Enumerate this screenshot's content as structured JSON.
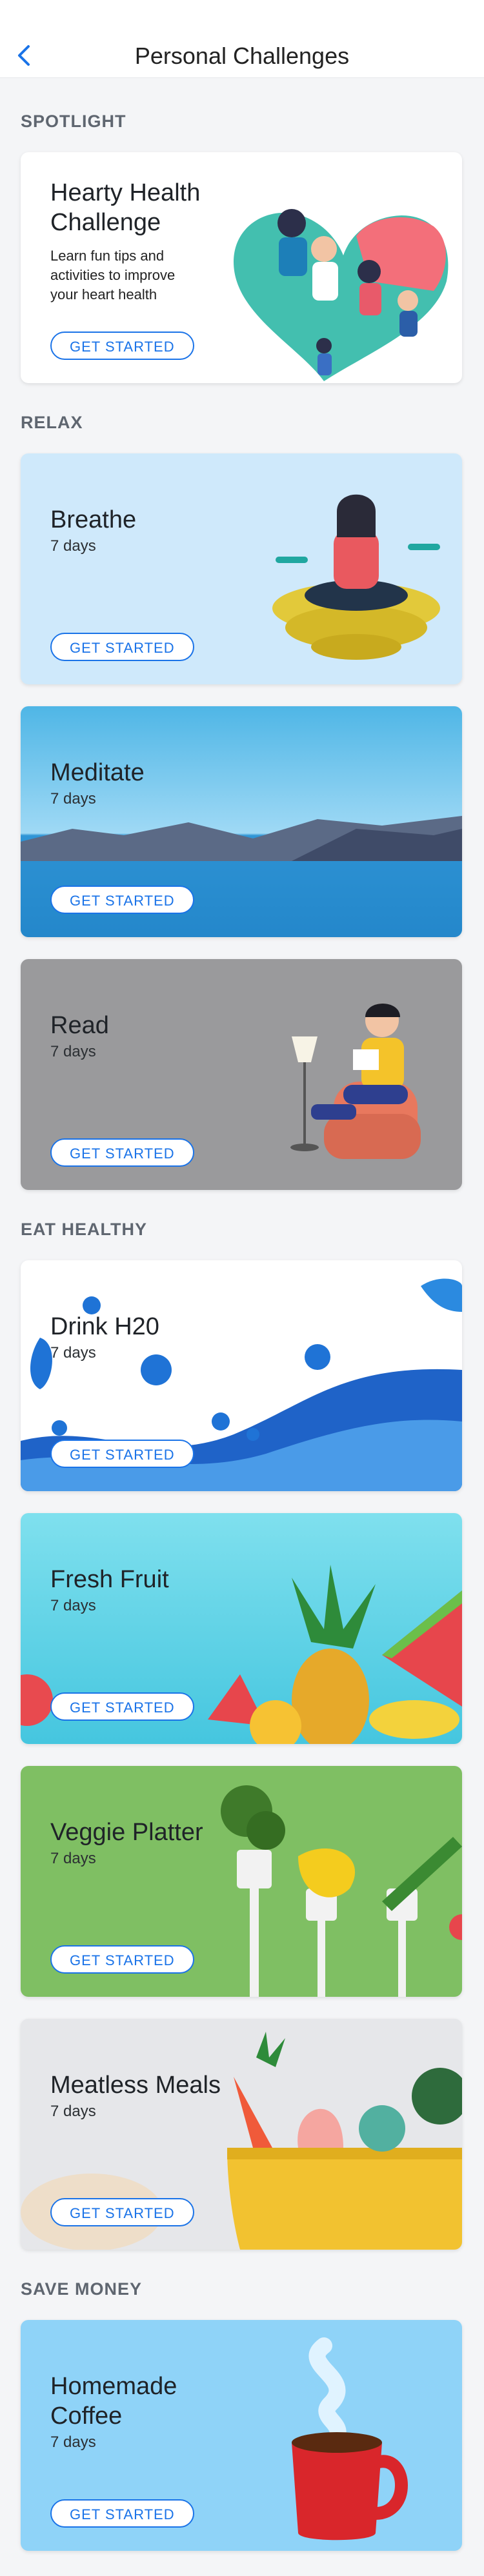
{
  "header": {
    "title": "Personal Challenges",
    "back_icon": "chevron-left-icon"
  },
  "sections": {
    "spotlight": {
      "title": "SPOTLIGHT"
    },
    "relax": {
      "title": "RELAX"
    },
    "eat": {
      "title": "EAT HEALTHY"
    },
    "money": {
      "title": "SAVE MONEY"
    }
  },
  "cards": {
    "hearty": {
      "name": "Hearty Health Challenge",
      "desc": "Learn fun tips and activities to improve your heart health",
      "button": "GET STARTED"
    },
    "breathe": {
      "name": "Breathe",
      "sub": "7 days",
      "button": "GET STARTED"
    },
    "meditate": {
      "name": "Meditate",
      "sub": "7 days",
      "button": "GET STARTED"
    },
    "read": {
      "name": "Read",
      "sub": "7 days",
      "button": "GET STARTED"
    },
    "drink": {
      "name": "Drink H20",
      "sub": "7 days",
      "button": "GET STARTED"
    },
    "fruit": {
      "name": "Fresh Fruit",
      "sub": "7 days",
      "button": "GET STARTED"
    },
    "veggie": {
      "name": "Veggie Platter",
      "sub": "7 days",
      "button": "GET STARTED"
    },
    "meatless": {
      "name": "Meatless Meals",
      "sub": "7 days",
      "button": "GET STARTED"
    },
    "coffee": {
      "name": "Homemade Coffee",
      "sub": "7 days",
      "button": "GET STARTED"
    }
  },
  "colors": {
    "accent": "#1a73e8"
  }
}
